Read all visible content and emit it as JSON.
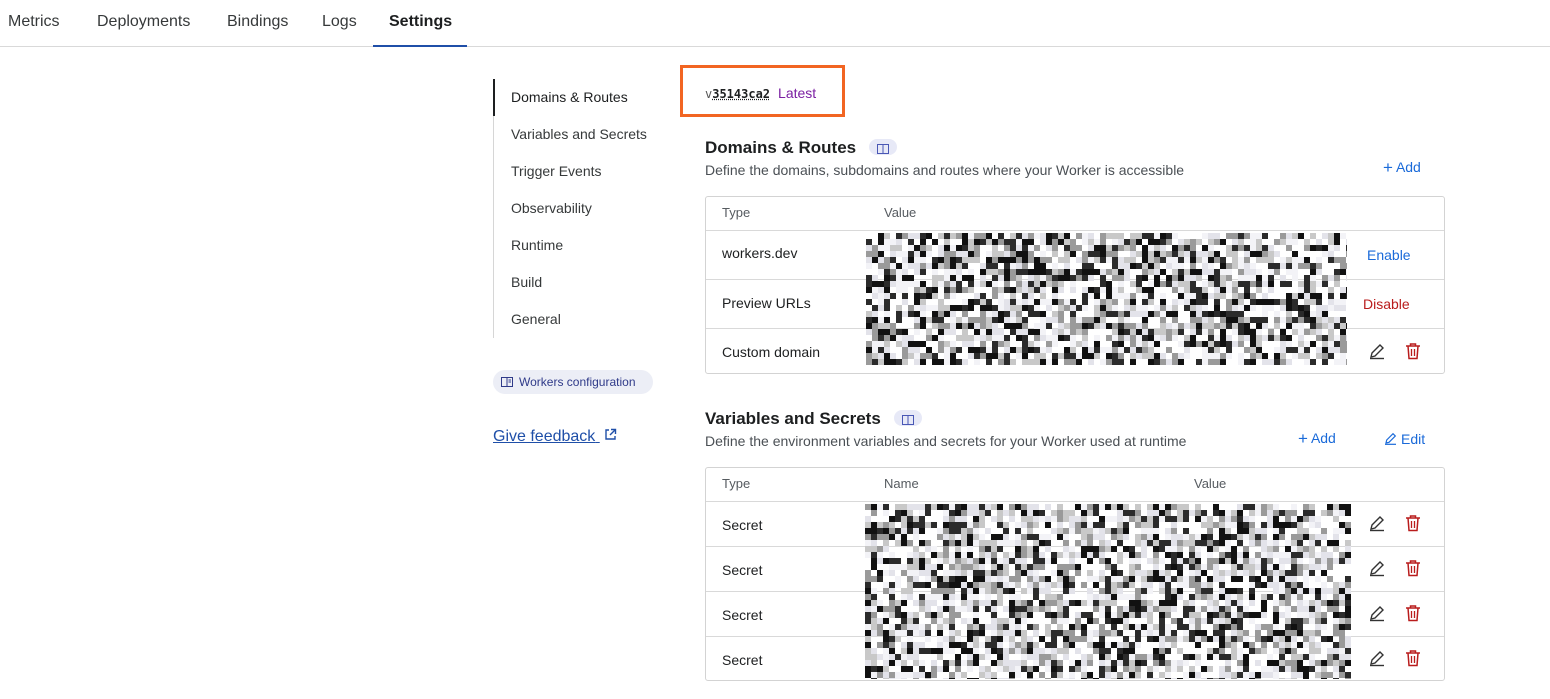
{
  "tabs": [
    {
      "label": "Metrics"
    },
    {
      "label": "Deployments"
    },
    {
      "label": "Bindings"
    },
    {
      "label": "Logs"
    },
    {
      "label": "Settings",
      "active": true
    }
  ],
  "subnav": {
    "items": [
      {
        "label": "Domains & Routes",
        "active": true
      },
      {
        "label": "Variables and Secrets"
      },
      {
        "label": "Trigger Events"
      },
      {
        "label": "Observability"
      },
      {
        "label": "Runtime"
      },
      {
        "label": "Build"
      },
      {
        "label": "General"
      }
    ],
    "config_label": "Workers configuration",
    "feedback_label": "Give feedback"
  },
  "version": {
    "prefix": "v",
    "hash": "35143ca2",
    "badge": "Latest"
  },
  "domains": {
    "title": "Domains & Routes",
    "description": "Define the domains, subdomains and routes where your Worker is accessible",
    "add_label": "Add",
    "headers": {
      "type": "Type",
      "value": "Value"
    },
    "rows": [
      {
        "type": "workers.dev",
        "action": "Enable"
      },
      {
        "type": "Preview URLs",
        "action": "Disable"
      },
      {
        "type": "Custom domain"
      }
    ]
  },
  "variables": {
    "title": "Variables and Secrets",
    "description": "Define the environment variables and secrets for your Worker used at runtime",
    "add_label": "Add",
    "edit_label": "Edit",
    "headers": {
      "type": "Type",
      "name": "Name",
      "value": "Value"
    },
    "rows": [
      {
        "type": "Secret"
      },
      {
        "type": "Secret"
      },
      {
        "type": "Secret"
      },
      {
        "type": "Secret"
      }
    ]
  },
  "colors": {
    "accent": "#1a6ad9",
    "danger": "#b91c1c",
    "highlight": "#f26522",
    "latest": "#7b1fa2",
    "active_tab": "#1f4fa8"
  }
}
